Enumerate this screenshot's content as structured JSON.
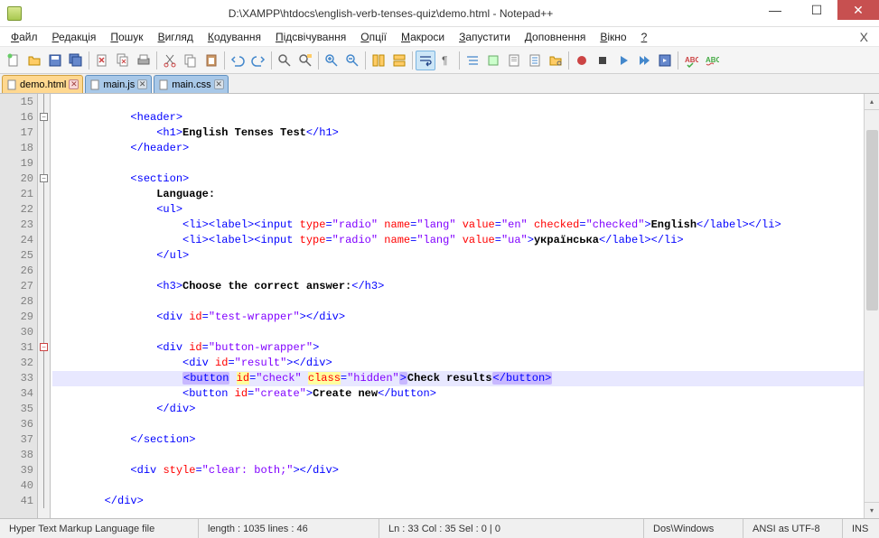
{
  "window": {
    "title": "D:\\XAMPP\\htdocs\\english-verb-tenses-quiz\\demo.html - Notepad++"
  },
  "menu": {
    "items": [
      "Файл",
      "Редакція",
      "Пошук",
      "Вигляд",
      "Кодування",
      "Підсвічування",
      "Опції",
      "Макроси",
      "Запустити",
      "Доповнення",
      "Вікно",
      "?"
    ]
  },
  "tabs": [
    {
      "name": "demo.html",
      "active": true
    },
    {
      "name": "main.js",
      "active": false
    },
    {
      "name": "main.css",
      "active": false
    }
  ],
  "editor": {
    "first_line": 15,
    "current_line": 33,
    "lines": [
      {
        "n": 15,
        "indent": 2,
        "raw": ""
      },
      {
        "n": 16,
        "indent": 3,
        "tokens": [
          [
            "tag",
            "<header>"
          ]
        ]
      },
      {
        "n": 17,
        "indent": 4,
        "tokens": [
          [
            "tag",
            "<h1>"
          ],
          [
            "text",
            "English Tenses Test"
          ],
          [
            "tag",
            "</h1>"
          ]
        ]
      },
      {
        "n": 18,
        "indent": 3,
        "tokens": [
          [
            "tag",
            "</header>"
          ]
        ]
      },
      {
        "n": 19,
        "indent": 3,
        "raw": ""
      },
      {
        "n": 20,
        "indent": 3,
        "tokens": [
          [
            "tag",
            "<section>"
          ]
        ]
      },
      {
        "n": 21,
        "indent": 4,
        "tokens": [
          [
            "text",
            "Language:"
          ]
        ]
      },
      {
        "n": 22,
        "indent": 4,
        "tokens": [
          [
            "tag",
            "<ul>"
          ]
        ]
      },
      {
        "n": 23,
        "indent": 5,
        "tokens": [
          [
            "tag",
            "<li><label><input "
          ],
          [
            "attr",
            "type"
          ],
          [
            "tag",
            "="
          ],
          [
            "val",
            "\"radio\""
          ],
          [
            "tag",
            " "
          ],
          [
            "attr",
            "name"
          ],
          [
            "tag",
            "="
          ],
          [
            "val",
            "\"lang\""
          ],
          [
            "tag",
            " "
          ],
          [
            "attr",
            "value"
          ],
          [
            "tag",
            "="
          ],
          [
            "val",
            "\"en\""
          ],
          [
            "tag",
            " "
          ],
          [
            "attr",
            "checked"
          ],
          [
            "tag",
            "="
          ],
          [
            "val",
            "\"checked\""
          ],
          [
            "tag",
            ">"
          ],
          [
            "text",
            "English"
          ],
          [
            "tag",
            "</label></li>"
          ]
        ]
      },
      {
        "n": 24,
        "indent": 5,
        "tokens": [
          [
            "tag",
            "<li><label><input "
          ],
          [
            "attr",
            "type"
          ],
          [
            "tag",
            "="
          ],
          [
            "val",
            "\"radio\""
          ],
          [
            "tag",
            " "
          ],
          [
            "attr",
            "name"
          ],
          [
            "tag",
            "="
          ],
          [
            "val",
            "\"lang\""
          ],
          [
            "tag",
            " "
          ],
          [
            "attr",
            "value"
          ],
          [
            "tag",
            "="
          ],
          [
            "val",
            "\"ua\""
          ],
          [
            "tag",
            ">"
          ],
          [
            "text",
            "українська"
          ],
          [
            "tag",
            "</label></li>"
          ]
        ]
      },
      {
        "n": 25,
        "indent": 4,
        "tokens": [
          [
            "tag",
            "</ul>"
          ]
        ]
      },
      {
        "n": 26,
        "indent": 4,
        "raw": ""
      },
      {
        "n": 27,
        "indent": 4,
        "tokens": [
          [
            "tag",
            "<h3>"
          ],
          [
            "text",
            "Choose the correct answer:"
          ],
          [
            "tag",
            "</h3>"
          ]
        ]
      },
      {
        "n": 28,
        "indent": 4,
        "raw": ""
      },
      {
        "n": 29,
        "indent": 4,
        "tokens": [
          [
            "tag",
            "<div "
          ],
          [
            "attr",
            "id"
          ],
          [
            "tag",
            "="
          ],
          [
            "val",
            "\"test-wrapper\""
          ],
          [
            "tag",
            "></div>"
          ]
        ]
      },
      {
        "n": 30,
        "indent": 4,
        "raw": ""
      },
      {
        "n": 31,
        "indent": 4,
        "tokens": [
          [
            "tag",
            "<div "
          ],
          [
            "attr",
            "id"
          ],
          [
            "tag",
            "="
          ],
          [
            "val",
            "\"button-wrapper\""
          ],
          [
            "tag",
            ">"
          ]
        ]
      },
      {
        "n": 32,
        "indent": 5,
        "tokens": [
          [
            "tag",
            "<div "
          ],
          [
            "attr",
            "id"
          ],
          [
            "tag",
            "="
          ],
          [
            "val",
            "\"result\""
          ],
          [
            "tag",
            "></div>"
          ]
        ]
      },
      {
        "n": 33,
        "indent": 5,
        "current": true,
        "tokens": [
          [
            "hltag",
            "<button"
          ],
          [
            "tag",
            " "
          ],
          [
            "attr",
            "id"
          ],
          [
            "tag",
            "="
          ],
          [
            "val",
            "\"check\""
          ],
          [
            "tag",
            " "
          ],
          [
            "attr",
            "class"
          ],
          [
            "tag",
            "="
          ],
          [
            "val",
            "\"hidden\""
          ],
          [
            "hltag",
            ">"
          ],
          [
            "text",
            "Check results"
          ],
          [
            "hltag",
            "</button>"
          ]
        ]
      },
      {
        "n": 34,
        "indent": 5,
        "tokens": [
          [
            "tag",
            "<button "
          ],
          [
            "attr",
            "id"
          ],
          [
            "tag",
            "="
          ],
          [
            "val",
            "\"create\""
          ],
          [
            "tag",
            ">"
          ],
          [
            "text",
            "Create new"
          ],
          [
            "tag",
            "</button>"
          ]
        ]
      },
      {
        "n": 35,
        "indent": 4,
        "tokens": [
          [
            "tag",
            "</div>"
          ]
        ]
      },
      {
        "n": 36,
        "indent": 4,
        "raw": ""
      },
      {
        "n": 37,
        "indent": 3,
        "tokens": [
          [
            "tag",
            "</section>"
          ]
        ]
      },
      {
        "n": 38,
        "indent": 3,
        "raw": ""
      },
      {
        "n": 39,
        "indent": 3,
        "tokens": [
          [
            "tag",
            "<div "
          ],
          [
            "attr",
            "style"
          ],
          [
            "tag",
            "="
          ],
          [
            "val",
            "\"clear: both;\""
          ],
          [
            "tag",
            "></div>"
          ]
        ]
      },
      {
        "n": 40,
        "indent": 3,
        "raw": ""
      },
      {
        "n": 41,
        "indent": 2,
        "tokens": [
          [
            "tag",
            "</div>"
          ]
        ]
      }
    ]
  },
  "status": {
    "filetype": "Hyper Text Markup Language file",
    "length": "length : 1035    lines : 46",
    "pos": "Ln : 33    Col : 35    Sel : 0 | 0",
    "eol": "Dos\\Windows",
    "encoding": "ANSI as UTF-8",
    "mode": "INS"
  }
}
